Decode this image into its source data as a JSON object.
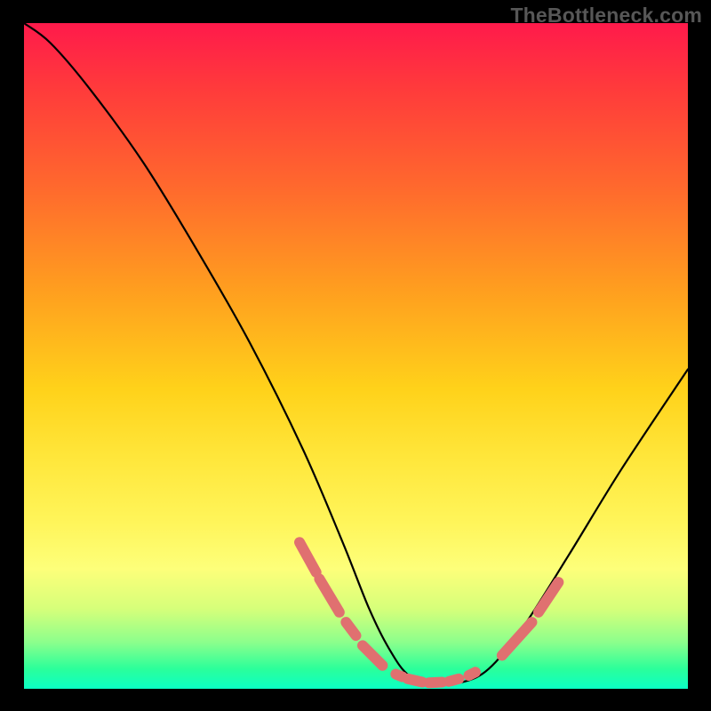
{
  "watermark": "TheBottleneck.com",
  "chart_data": {
    "type": "line",
    "title": "",
    "xlabel": "",
    "ylabel": "",
    "xlim": [
      0,
      100
    ],
    "ylim": [
      0,
      100
    ],
    "series": [
      {
        "name": "bottleneck-curve",
        "x": [
          0,
          4,
          10,
          18,
          26,
          34,
          42,
          48,
          52,
          55,
          58,
          62,
          66,
          70,
          75,
          82,
          90,
          100
        ],
        "values": [
          100,
          97,
          90,
          79,
          66,
          52,
          36,
          22,
          12,
          6,
          2,
          1,
          1,
          3,
          9,
          20,
          33,
          48
        ]
      }
    ],
    "markers": {
      "name": "highlight-segments",
      "color": "#e07070",
      "segments": [
        {
          "x": [
            41.5,
            44.0
          ],
          "values": [
            22.0,
            17.5
          ]
        },
        {
          "x": [
            44.5,
            47.5
          ],
          "values": [
            16.5,
            11.5
          ]
        },
        {
          "x": [
            48.5,
            50.0
          ],
          "values": [
            10.0,
            8.0
          ]
        },
        {
          "x": [
            51.0,
            54.0
          ],
          "values": [
            6.5,
            3.5
          ]
        },
        {
          "x": [
            56.0,
            57.0
          ],
          "values": [
            2.2,
            1.8
          ]
        },
        {
          "x": [
            57.8,
            60.0
          ],
          "values": [
            1.5,
            1.0
          ]
        },
        {
          "x": [
            61.0,
            63.0
          ],
          "values": [
            0.9,
            1.0
          ]
        },
        {
          "x": [
            64.0,
            65.5
          ],
          "values": [
            1.1,
            1.5
          ]
        },
        {
          "x": [
            67.0,
            68.0
          ],
          "values": [
            2.0,
            2.5
          ]
        },
        {
          "x": [
            72.0,
            76.5
          ],
          "values": [
            5.0,
            10.0
          ]
        },
        {
          "x": [
            77.5,
            80.5
          ],
          "values": [
            11.5,
            16.0
          ]
        }
      ]
    }
  }
}
